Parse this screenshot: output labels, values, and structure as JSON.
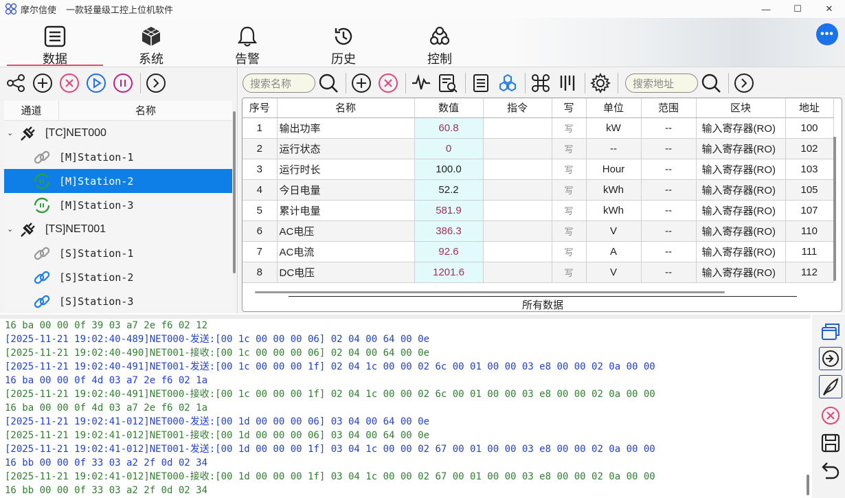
{
  "titlebar": {
    "app_name": "摩尔信使",
    "subtitle": "一款轻量级工控上位机软件",
    "minimize": "—",
    "maximize": "☐",
    "close": "✕"
  },
  "nav": {
    "tabs": [
      {
        "label": "数据",
        "icon": "list-icon",
        "active": true
      },
      {
        "label": "系统",
        "icon": "cube-icon",
        "active": false
      },
      {
        "label": "告警",
        "icon": "bell-icon",
        "active": false
      },
      {
        "label": "历史",
        "icon": "history-icon",
        "active": false
      },
      {
        "label": "控制",
        "icon": "control-icon",
        "active": false
      }
    ],
    "user_menu": "•••"
  },
  "tree": {
    "col_channel": "通道",
    "col_name": "名称",
    "rows": [
      {
        "label": "[TC]NET000",
        "type": "channel",
        "icon": "plug-icon"
      },
      {
        "label": "[M]Station-1",
        "type": "station",
        "icon": "link-gray-icon"
      },
      {
        "label": "[M]Station-2",
        "type": "station",
        "icon": "sync-green-icon",
        "selected": true
      },
      {
        "label": "[M]Station-3",
        "type": "station",
        "icon": "sync-green-icon"
      },
      {
        "label": "[TS]NET001",
        "type": "channel",
        "icon": "plug-icon"
      },
      {
        "label": "[S]Station-1",
        "type": "station",
        "icon": "link-gray-icon"
      },
      {
        "label": "[S]Station-2",
        "type": "station",
        "icon": "link-blue-icon"
      },
      {
        "label": "[S]Station-3",
        "type": "station",
        "icon": "link-blue-icon"
      }
    ]
  },
  "toolbar": {
    "search_name_placeholder": "搜索名称",
    "search_addr_placeholder": "搜索地址"
  },
  "grid": {
    "columns": [
      "序号",
      "名称",
      "数值",
      "指令",
      "写",
      "单位",
      "范围",
      "区块",
      "地址"
    ],
    "rows": [
      {
        "idx": "1",
        "name": "输出功率",
        "value": "60.8",
        "cmd": "",
        "write": "写",
        "unit": "kW",
        "range": "--",
        "block": "输入寄存器(RO)",
        "addr": "100",
        "highlight": true
      },
      {
        "idx": "2",
        "name": "运行状态",
        "value": "0",
        "cmd": "",
        "write": "写",
        "unit": "--",
        "range": "--",
        "block": "输入寄存器(RO)",
        "addr": "102",
        "highlight": true
      },
      {
        "idx": "3",
        "name": "运行时长",
        "value": "100.0",
        "cmd": "",
        "write": "写",
        "unit": "Hour",
        "range": "--",
        "block": "输入寄存器(RO)",
        "addr": "103",
        "highlight": false
      },
      {
        "idx": "4",
        "name": "今日电量",
        "value": "52.2",
        "cmd": "",
        "write": "写",
        "unit": "kWh",
        "range": "--",
        "block": "输入寄存器(RO)",
        "addr": "105",
        "highlight": false
      },
      {
        "idx": "5",
        "name": "累计电量",
        "value": "581.9",
        "cmd": "",
        "write": "写",
        "unit": "kWh",
        "range": "--",
        "block": "输入寄存器(RO)",
        "addr": "107",
        "highlight": true
      },
      {
        "idx": "6",
        "name": "AC电压",
        "value": "386.3",
        "cmd": "",
        "write": "写",
        "unit": "V",
        "range": "--",
        "block": "输入寄存器(RO)",
        "addr": "110",
        "highlight": true
      },
      {
        "idx": "7",
        "name": "AC电流",
        "value": "92.6",
        "cmd": "",
        "write": "写",
        "unit": "A",
        "range": "--",
        "block": "输入寄存器(RO)",
        "addr": "111",
        "highlight": true
      },
      {
        "idx": "8",
        "name": "DC电压",
        "value": "1201.6",
        "cmd": "",
        "write": "写",
        "unit": "V",
        "range": "--",
        "block": "输入寄存器(RO)",
        "addr": "112",
        "highlight": true
      }
    ],
    "bottom_tab": "所有数据"
  },
  "log": {
    "lines": [
      {
        "text": "16 ba 00 00 0f 39 03 a7 2e f6 02 12",
        "kind": "recv"
      },
      {
        "text": "[2025-11-21 19:02:40-489]NET000-发送:[00 1c 00 00 00 06] 02 04 00 64 00 0e",
        "kind": "send"
      },
      {
        "text": "[2025-11-21 19:02:40-490]NET001-接收:[00 1c 00 00 00 06] 02 04 00 64 00 0e",
        "kind": "recv"
      },
      {
        "text": "[2025-11-21 19:02:40-491]NET001-发送:[00 1c 00 00 00 1f] 02 04 1c 00 00 02 6c 00 01 00 00 03 e8 00 00 02 0a 00 00",
        "kind": "send"
      },
      {
        "text": "16 ba 00 00 0f 4d 03 a7 2e f6 02 1a",
        "kind": "send"
      },
      {
        "text": "[2025-11-21 19:02:40-491]NET000-接收:[00 1c 00 00 00 1f] 02 04 1c 00 00 02 6c 00 01 00 00 03 e8 00 00 02 0a 00 00",
        "kind": "recv"
      },
      {
        "text": "16 ba 00 00 0f 4d 03 a7 2e f6 02 1a",
        "kind": "recv"
      },
      {
        "text": "[2025-11-21 19:02:41-012]NET000-发送:[00 1d 00 00 00 06] 03 04 00 64 00 0e",
        "kind": "send"
      },
      {
        "text": "[2025-11-21 19:02:41-012]NET001-接收:[00 1d 00 00 00 06] 03 04 00 64 00 0e",
        "kind": "recv"
      },
      {
        "text": "[2025-11-21 19:02:41-012]NET001-发送:[00 1d 00 00 00 1f] 03 04 1c 00 00 02 67 00 01 00 00 03 e8 00 00 02 0a 00 00",
        "kind": "send"
      },
      {
        "text": "16 bb 00 00 0f 33 03 a2 2f 0d 02 34",
        "kind": "send"
      },
      {
        "text": "[2025-11-21 19:02:41-012]NET000-接收:[00 1d 00 00 00 1f] 03 04 1c 00 00 02 67 00 01 00 00 03 e8 00 00 02 0a 00 00",
        "kind": "recv"
      },
      {
        "text": "16 bb 00 00 0f 33 03 a2 2f 0d 02 34",
        "kind": "recv"
      }
    ]
  },
  "colors": {
    "send": "#1f3fd9",
    "recv": "#2f7f2f",
    "selected_row": "#0d7fe6",
    "value_text": "#a0305a",
    "value_bg": "#e2fafb"
  }
}
